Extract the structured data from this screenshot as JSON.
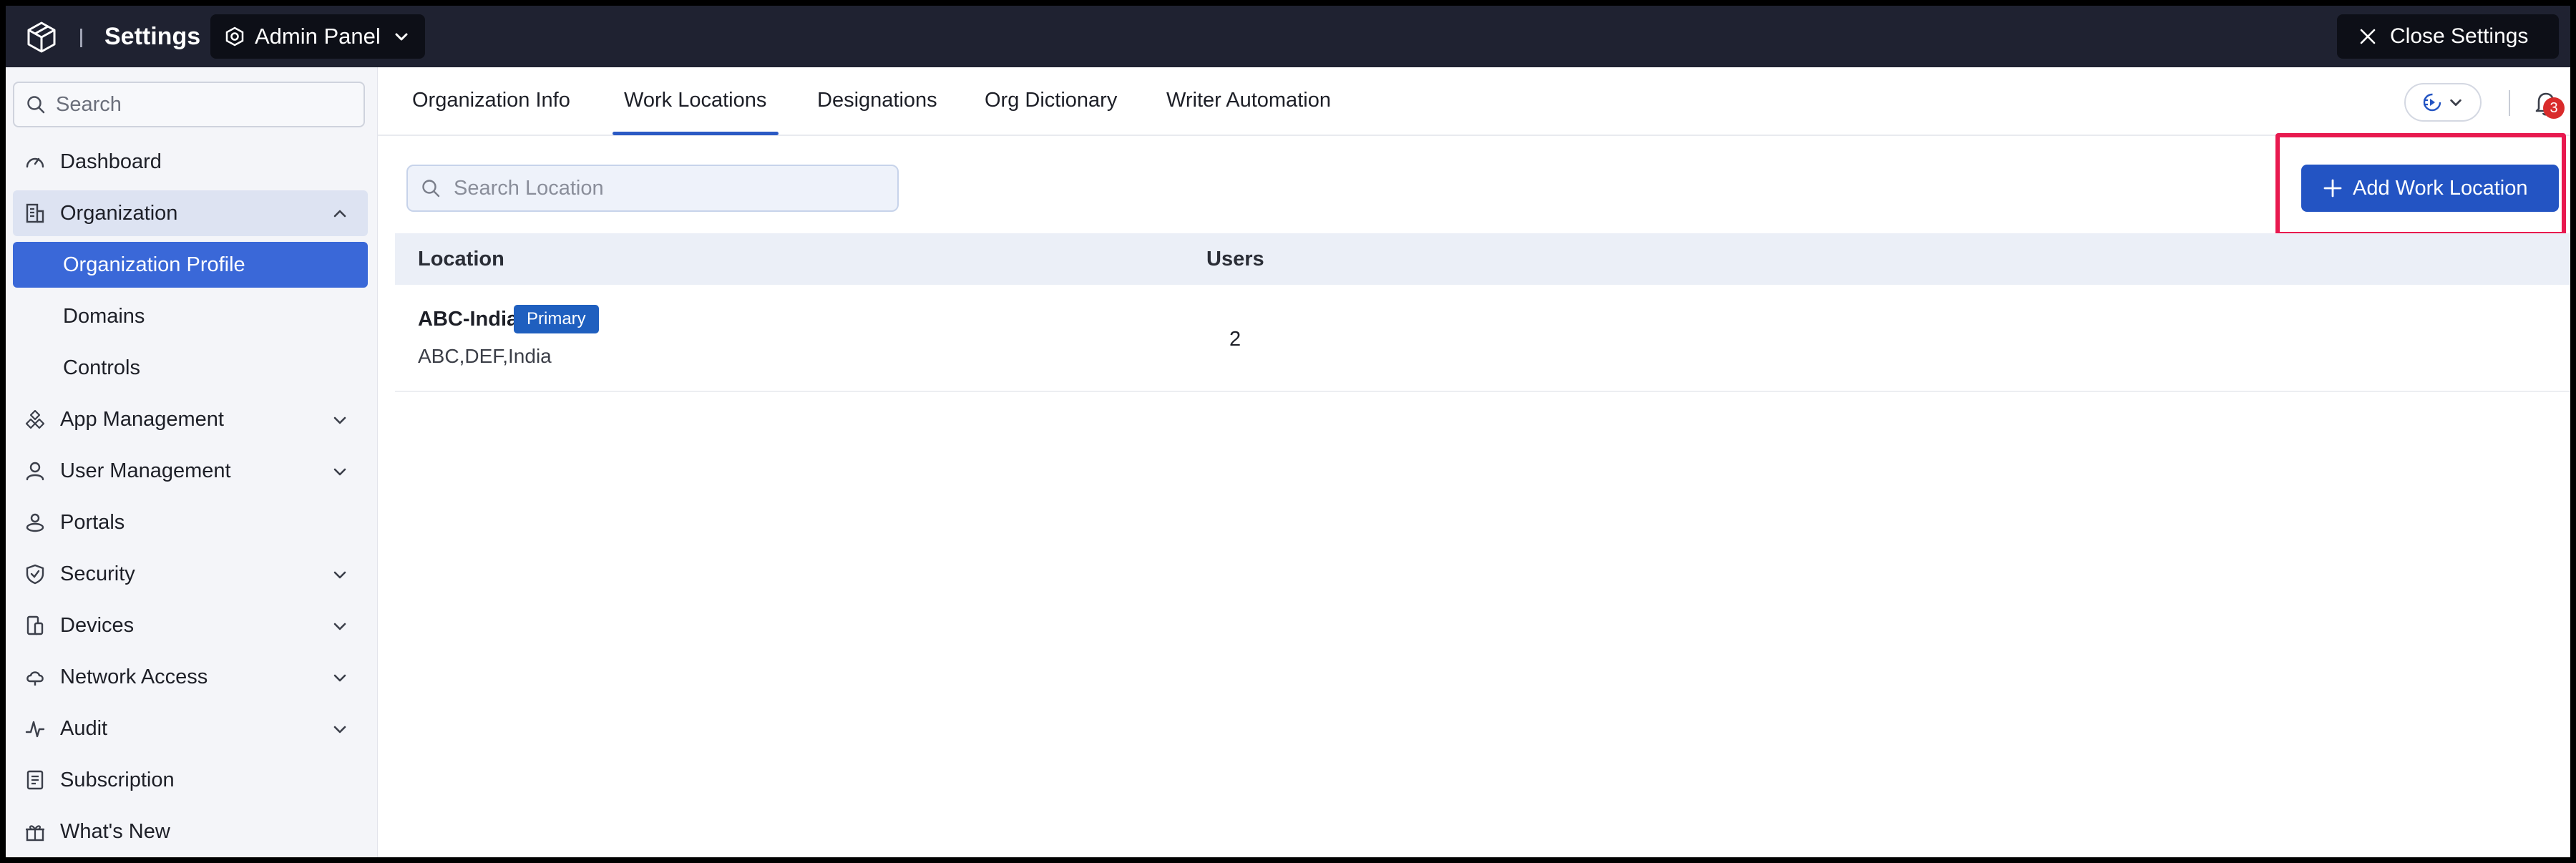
{
  "header": {
    "title": "Settings",
    "context_label": "Admin Panel",
    "close_label": "Close Settings"
  },
  "sidebar": {
    "search_placeholder": "Search",
    "items": [
      {
        "label": "Dashboard",
        "icon": "gauge-icon"
      },
      {
        "label": "Organization",
        "icon": "building-icon",
        "expanded": true
      },
      {
        "label": "Organization Profile",
        "sub": true,
        "active": true
      },
      {
        "label": "Domains",
        "sub": true
      },
      {
        "label": "Controls",
        "sub": true
      },
      {
        "label": "App Management",
        "icon": "apps-icon"
      },
      {
        "label": "User Management",
        "icon": "user-icon"
      },
      {
        "label": "Portals",
        "icon": "portal-icon"
      },
      {
        "label": "Security",
        "icon": "shield-icon"
      },
      {
        "label": "Devices",
        "icon": "devices-icon"
      },
      {
        "label": "Network Access",
        "icon": "cloud-icon"
      },
      {
        "label": "Audit",
        "icon": "pulse-icon"
      },
      {
        "label": "Subscription",
        "icon": "receipt-icon"
      },
      {
        "label": "What's New",
        "icon": "gift-icon"
      }
    ]
  },
  "tabs": [
    {
      "label": "Organization Info"
    },
    {
      "label": "Work Locations",
      "active": true
    },
    {
      "label": "Designations"
    },
    {
      "label": "Org Dictionary"
    },
    {
      "label": "Writer Automation"
    }
  ],
  "notifications": {
    "count": "3"
  },
  "toolbar": {
    "search_placeholder": "Search Location",
    "add_label": "Add Work Location"
  },
  "table": {
    "columns": [
      "Location",
      "Users"
    ],
    "rows": [
      {
        "name": "ABC-India",
        "badge": "Primary",
        "address": "ABC,DEF,India",
        "users": "2"
      }
    ]
  },
  "colors": {
    "topbar": "#1f2231",
    "accent": "#2354c3",
    "active_nav": "#3a68d8",
    "highlight": "#e8194f",
    "badge_red": "#d92b2b"
  }
}
